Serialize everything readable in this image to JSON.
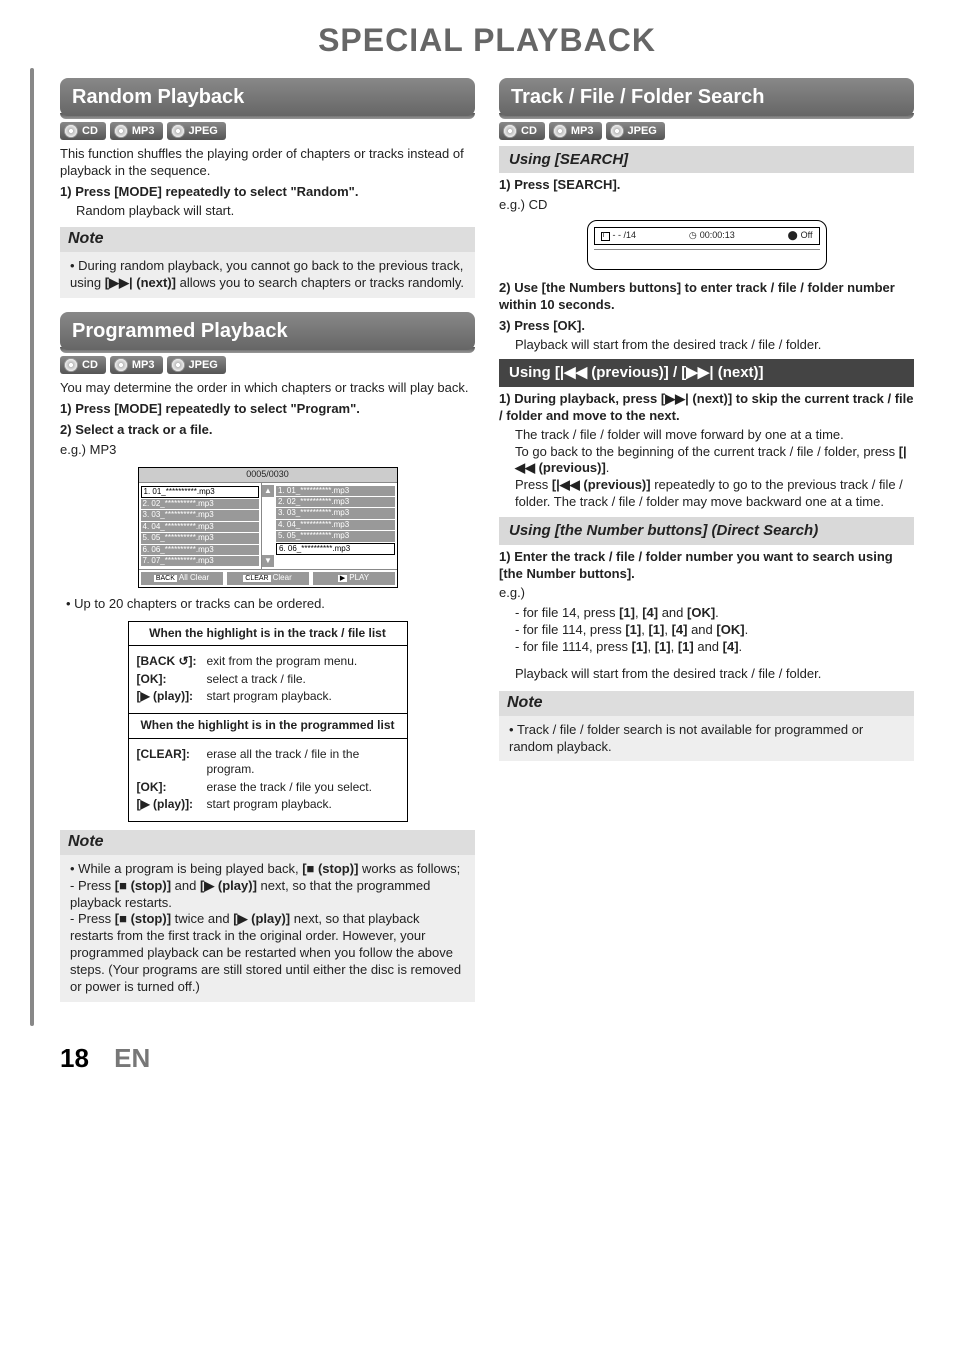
{
  "page": {
    "title": "SPECIAL PLAYBACK",
    "number": "18",
    "language": "EN"
  },
  "badges": {
    "cd": "CD",
    "mp3": "MP3",
    "jpeg": "JPEG"
  },
  "random": {
    "heading": "Random Playback",
    "intro": "This function shuffles the playing order of chapters or tracks instead of playback in the sequence.",
    "step1_num": "1)",
    "step1_title": "Press [MODE] repeatedly to select \"Random\".",
    "step1_body": "Random playback will start.",
    "note_head": "Note",
    "note_body_a": "During random playback, you cannot go back to the previous track, using ",
    "note_body_b": "[▶▶| (next)]",
    "note_body_c": " allows you to search chapters or tracks randomly."
  },
  "programmed": {
    "heading": "Programmed Playback",
    "intro": "You may determine the order in which chapters or tracks will play back.",
    "step1_num": "1)",
    "step1_title": "Press [MODE] repeatedly to select \"Program\".",
    "step2_num": "2)",
    "step2_title": "Select a track or a file.",
    "eg": "e.g.) MP3",
    "osd": {
      "counter": "0005/0030",
      "left": [
        "1. 01_**********.mp3",
        "2. 02_**********.mp3",
        "3. 03_**********.mp3",
        "4. 04_**********.mp3",
        "5. 05_**********.mp3",
        "6. 06_**********.mp3",
        "7. 07_**********.mp3"
      ],
      "right": [
        "1. 01_**********.mp3",
        "2. 02_**********.mp3",
        "3. 03_**********.mp3",
        "4. 04_**********.mp3",
        "5. 05_**********.mp3",
        "6. 06_**********.mp3"
      ],
      "btn_allclear_tag": "BACK",
      "btn_allclear": "All Clear",
      "btn_clear_tag": "CLEAR",
      "btn_clear": "Clear",
      "btn_play_tag": "▶",
      "btn_play": "PLAY"
    },
    "upto": "Up to 20 chapters or tracks can be ordered.",
    "table": {
      "hd1": "When the highlight is in the track / file list",
      "row1k": "[BACK ↺]:",
      "row1v": "exit from the program menu.",
      "row2k": "[OK]:",
      "row2v": "select a track / file.",
      "row3k": "[▶ (play)]:",
      "row3v": "start program playback.",
      "hd2": "When the highlight is in the programmed list",
      "row4k": "[CLEAR]:",
      "row4v": "erase all the track / file in the program.",
      "row5k": "[OK]:",
      "row5v": "erase the track / file you select.",
      "row6k": "[▶ (play)]:",
      "row6v": "start program playback."
    },
    "note_head": "Note",
    "note_intro_a": "While a program is being played back, ",
    "note_intro_b": "[■ (stop)]",
    "note_intro_c": " works as follows;",
    "note_li1_a": "Press ",
    "note_li1_b": "[■ (stop)]",
    "note_li1_c": " and ",
    "note_li1_d": "[▶ (play)]",
    "note_li1_e": " next, so that the programmed playback restarts.",
    "note_li2_a": "Press ",
    "note_li2_b": "[■ (stop)]",
    "note_li2_c": " twice and ",
    "note_li2_d": "[▶ (play)]",
    "note_li2_e": " next, so that playback restarts from the first track in the original order. However, your programmed playback can be restarted when you follow the above steps. (Your programs are still stored until either the disc is removed or power is turned off.)"
  },
  "search": {
    "heading": "Track / File / Folder Search",
    "sub_search": "Using [SEARCH]",
    "step1_num": "1)",
    "step1_title": "Press [SEARCH].",
    "eg_cd": "e.g.) CD",
    "cd_osd": {
      "track": "- - /14",
      "time": "00:00:13",
      "off": "Off",
      "t_icon": "T",
      "clock_icon": "◷",
      "rec_icon": "⬤"
    },
    "step2_num": "2)",
    "step2_title": "Use [the Numbers buttons] to enter track / file / folder number within 10 seconds.",
    "step3_num": "3)",
    "step3_title": "Press [OK].",
    "step3_body": "Playback will start from the desired track / file / folder.",
    "sub_prevnext": "Using [|◀◀ (previous)] / [▶▶| (next)]",
    "pn1_num": "1)",
    "pn1_a": "During playback, press ",
    "pn1_b": "[▶▶| (next)]",
    "pn1_c": " to skip the current track / file / folder and move to the next.",
    "pn1_body": "The track / file / folder will move forward by one at a time.",
    "pn2_a": "To go back to the beginning of the current track / file / folder, press ",
    "pn2_b": "[|◀◀ (previous)]",
    "pn2_c": ".",
    "pn3_a": "Press ",
    "pn3_b": "[|◀◀ (previous)]",
    "pn3_c": " repeatedly to go to the previous track / file / folder. The track / file / folder may move backward one at a time.",
    "sub_direct": "Using [the Number buttons] (Direct Search)",
    "d1_num": "1)",
    "d1_title": "Enter the track / file / folder number you want to search using [the Number buttons].",
    "d_eg": "e.g.)",
    "d_li1_a": "for file 14, press ",
    "d_li1_b": "[1]",
    "d_li1_c": ", ",
    "d_li1_d": "[4]",
    "d_li1_e": " and ",
    "d_li1_f": "[OK]",
    "d_li1_g": ".",
    "d_li2_a": "for file 114, press ",
    "d_li2_b": "[1]",
    "d_li2_c": ", ",
    "d_li2_d": "[1]",
    "d_li2_e": ", ",
    "d_li2_f": "[4]",
    "d_li2_g": " and ",
    "d_li2_h": "[OK]",
    "d_li2_i": ".",
    "d_li3_a": "for file 1114, press ",
    "d_li3_b": "[1]",
    "d_li3_c": ", ",
    "d_li3_d": "[1]",
    "d_li3_e": ", ",
    "d_li3_f": "[1]",
    "d_li3_g": " and ",
    "d_li3_h": "[4]",
    "d_li3_i": ".",
    "d_result": "Playback will start from the desired track / file / folder.",
    "note_head": "Note",
    "note_body": "Track / file / folder search is not available for programmed or random playback."
  }
}
